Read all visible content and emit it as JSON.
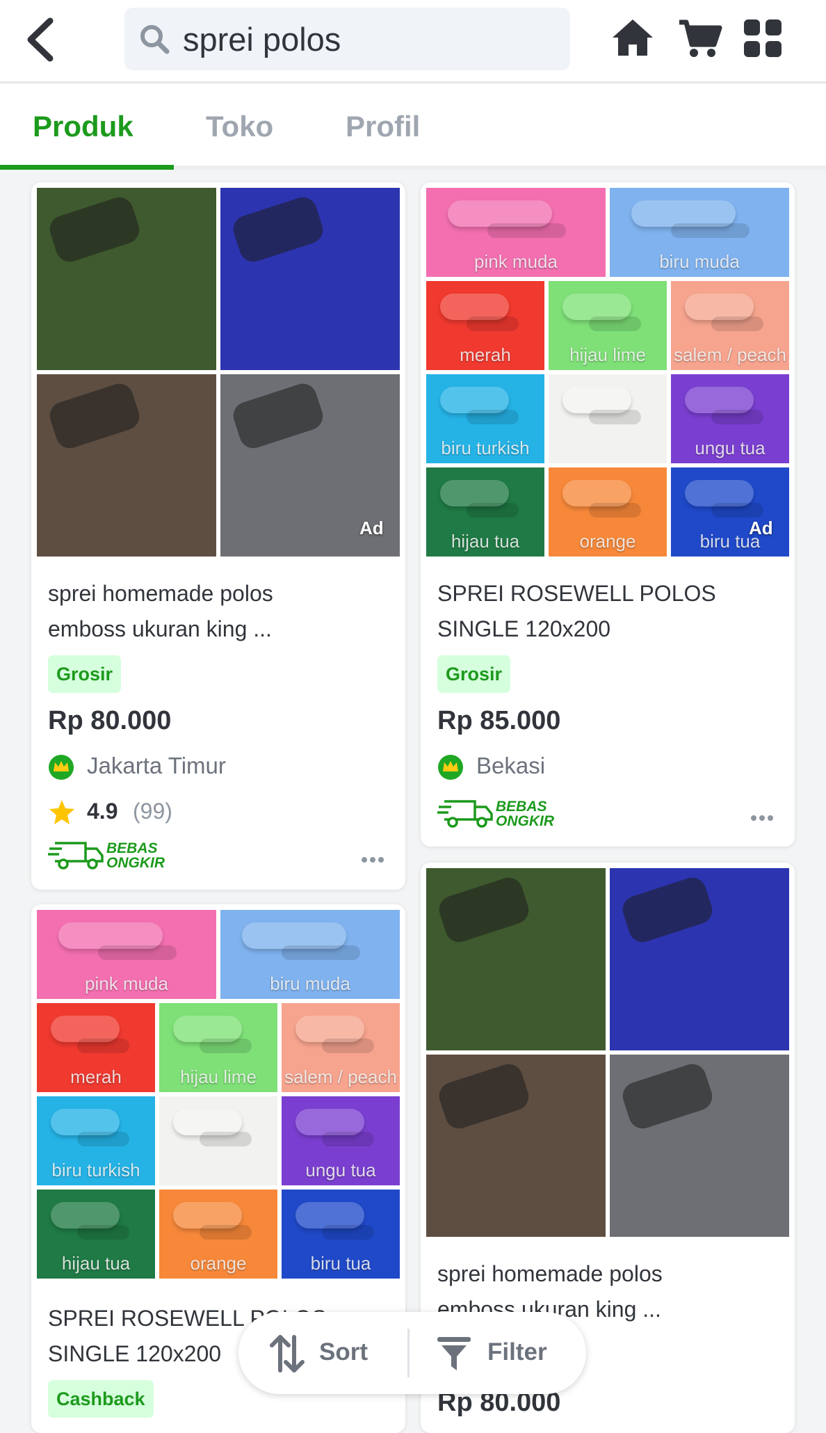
{
  "header": {
    "search_value": "sprei polos",
    "icons": [
      "back-arrow-icon",
      "search-icon",
      "home-icon",
      "cart-icon",
      "grid-menu-icon"
    ]
  },
  "tabs": [
    {
      "label": "Produk",
      "active": true
    },
    {
      "label": "Toko",
      "active": false
    },
    {
      "label": "Profil",
      "active": false
    }
  ],
  "products": [
    {
      "title_line1": "sprei homemade polos",
      "title_line2": "emboss ukuran king ...",
      "tag": "Grosir",
      "price": "Rp 80.000",
      "location": "Jakarta Timur",
      "rating": "4.9",
      "rating_count": "(99)",
      "ad": "Ad",
      "shipping_line1": "BEBAS",
      "shipping_line2": "ONGKIR"
    },
    {
      "title_line1": "SPREI ROSEWELL POLOS",
      "title_line2": "SINGLE 120x200",
      "tag": "Grosir",
      "price": "Rp 85.000",
      "location": "Bekasi",
      "ad": "Ad",
      "shipping_line1": "BEBAS",
      "shipping_line2": "ONGKIR"
    },
    {
      "title_line1": "SPREI ROSEWELL POLOS",
      "title_line2": "SINGLE 120x200",
      "tag": "Cashback"
    },
    {
      "title_line1": "sprei homemade polos",
      "title_line2": "emboss ukuran king ...",
      "price": "Rp 80.000"
    }
  ],
  "colors_4grid": [
    "#3f5a2e",
    "#2c34b0",
    "#5e4e42",
    "#6e6f74"
  ],
  "colors_11grid": [
    {
      "label": "pink muda",
      "color": "#f36fb0"
    },
    {
      "label": "biru muda",
      "color": "#7fb2ee"
    },
    {
      "label": "merah",
      "color": "#f0392f"
    },
    {
      "label": "hijau lime",
      "color": "#7ee077"
    },
    {
      "label": "salem / peach",
      "color": "#f6a48e"
    },
    {
      "label": "biru turkish",
      "color": "#25b3e6"
    },
    {
      "label": "",
      "color": "#f2f2f0"
    },
    {
      "label": "ungu tua",
      "color": "#7a3fd0"
    },
    {
      "label": "hijau tua",
      "color": "#1f7a45"
    },
    {
      "label": "orange",
      "color": "#f7883a"
    },
    {
      "label": "biru tua",
      "color": "#1f49c9"
    }
  ],
  "bottom_bar": {
    "sort_label": "Sort",
    "filter_label": "Filter"
  },
  "accent_color": "#1c9a1c"
}
